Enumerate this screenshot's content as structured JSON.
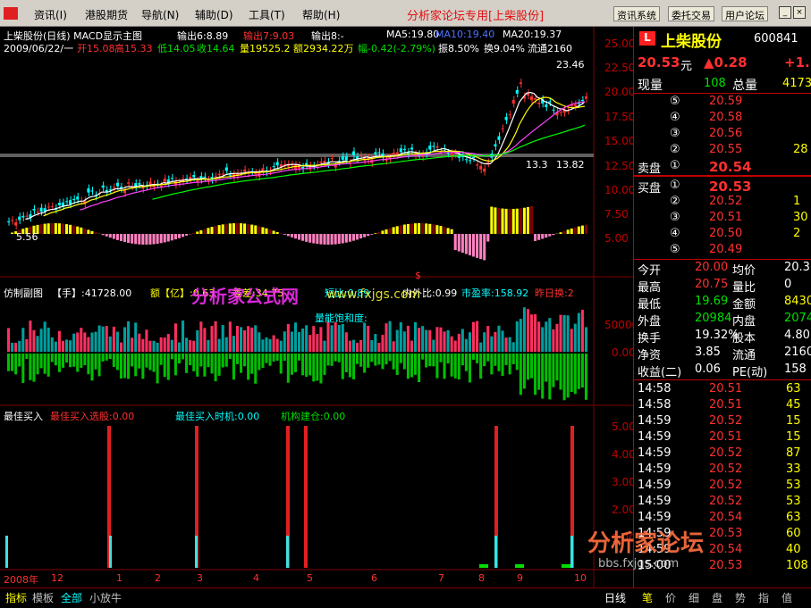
{
  "menu": {
    "items": [
      "资讯(I)",
      "港股期货",
      "导航(N)",
      "辅助(D)",
      "工具(T)",
      "帮助(H)"
    ],
    "title": "分析家论坛专用[上柴股份]",
    "buttons": [
      "资讯系统",
      "委托交易",
      "用户论坛"
    ]
  },
  "header": {
    "line1": "上柴股份(日线) MACD显示主图",
    "out1": "输出6:8.89",
    "out2": "输出7:9.03",
    "out3": "输出8:-",
    "ma5": "MA5:19.80",
    "ma10": "MA10:19.40",
    "ma20": "MA20:19.37",
    "date": "2009/06/22/一",
    "open": "开15.08",
    "high": "高15.33",
    "low": "低14.05",
    "close": "收14.64",
    "vol": "量19525.2",
    "amt": "额2934.22万",
    "chg": "幅-0.42(-2.79%)",
    "amp": "振8.50%",
    "turn": "换9.04%",
    "flow": "流通2160"
  },
  "price_ticks": [
    "25.00",
    "22.50",
    "20.00",
    "17.50",
    "15.00",
    "12.50",
    "10.00",
    "7.50",
    "5.00"
  ],
  "chart_marks": {
    "high": "23.46",
    "low": "13.82",
    "low2": "13.3",
    "left": "5.56",
    "dollar": "$"
  },
  "sub1": {
    "label": "仿制副图",
    "hand": "【手】:41728.00",
    "amount": "额【亿】:0.63",
    "other": "委差:34.75",
    "ratio": "短比:0.89",
    "inout": "内外比:0.99",
    "pe": "市盈率:158.92",
    "prev": "昨日换:2",
    "sat": "量能饱和度:",
    "ticks": [
      "50000",
      "0.00"
    ]
  },
  "sub2": {
    "label": "最佳买入",
    "buy1": "最佳买入选股:0.00",
    "buy2": "最佳买入时机:0.00",
    "buy3": "机构建仓:0.00",
    "ticks": [
      "5.00",
      "4.00",
      "3.00",
      "2.00",
      "1.00"
    ]
  },
  "months": [
    "2008年",
    "12",
    "1",
    "2",
    "3",
    "4",
    "5",
    "6",
    "7",
    "8",
    "9",
    "10"
  ],
  "watermark": {
    "a": "分析家公式网",
    "b": "www.fxjgs.com",
    "c": "分析家论坛",
    "d": "bbs.fxjgs.com"
  },
  "bottom_tabs": [
    "指标",
    "模板",
    "全部",
    "小放牛"
  ],
  "period": "日线",
  "right_tabs": [
    "笔",
    "价",
    "细",
    "盘",
    "势",
    "指",
    "值"
  ],
  "quote": {
    "logo": "L",
    "name": "上柴股份",
    "code": "600841",
    "price": "20.53",
    "unit": "元",
    "arrow": "▲0.28",
    "pct": "+1.",
    "now_label": "现量",
    "now_val": "108",
    "total_label": "总量",
    "total_val": "4173",
    "asks": [
      {
        "lvl": "⑤",
        "p": "20.59",
        "v": ""
      },
      {
        "lvl": "④",
        "p": "20.58",
        "v": ""
      },
      {
        "lvl": "③",
        "p": "20.56",
        "v": ""
      },
      {
        "lvl": "②",
        "p": "20.55",
        "v": "28"
      },
      {
        "lvl": "①",
        "p": "20.54",
        "v": ""
      }
    ],
    "ask_label": "卖盘",
    "bid_label": "买盘",
    "bids": [
      {
        "lvl": "①",
        "p": "20.53",
        "v": ""
      },
      {
        "lvl": "②",
        "p": "20.52",
        "v": "1"
      },
      {
        "lvl": "③",
        "p": "20.51",
        "v": "30"
      },
      {
        "lvl": "④",
        "p": "20.50",
        "v": "2"
      },
      {
        "lvl": "⑤",
        "p": "20.49",
        "v": ""
      }
    ],
    "stats": [
      {
        "a": "今开",
        "av": "20.00",
        "b": "均价",
        "bv": "20.3"
      },
      {
        "a": "最高",
        "av": "20.75",
        "b": "量比",
        "bv": "0"
      },
      {
        "a": "最低",
        "av": "19.69",
        "b": "金额",
        "bv": "8430"
      },
      {
        "a": "外盘",
        "av": "20984",
        "b": "内盘",
        "bv": "2074"
      },
      {
        "a": "换手",
        "av": "19.32%",
        "b": "股本",
        "bv": "4.80"
      },
      {
        "a": "净资",
        "av": "3.85",
        "b": "流通",
        "bv": "2160"
      },
      {
        "a": "收益(二)",
        "av": "0.06",
        "b": "PE(动)",
        "bv": "158"
      }
    ],
    "ticks": [
      {
        "t": "14:58",
        "p": "20.51",
        "v": "63"
      },
      {
        "t": "14:58",
        "p": "20.51",
        "v": "45"
      },
      {
        "t": "14:59",
        "p": "20.52",
        "v": "15"
      },
      {
        "t": "14:59",
        "p": "20.51",
        "v": "15"
      },
      {
        "t": "14:59",
        "p": "20.52",
        "v": "87"
      },
      {
        "t": "14:59",
        "p": "20.52",
        "v": "33"
      },
      {
        "t": "14:59",
        "p": "20.52",
        "v": "53"
      },
      {
        "t": "14:59",
        "p": "20.52",
        "v": "53"
      },
      {
        "t": "14:59",
        "p": "20.54",
        "v": "63"
      },
      {
        "t": "14:59",
        "p": "20.53",
        "v": "60"
      },
      {
        "t": "14:59",
        "p": "20.54",
        "v": "40"
      },
      {
        "t": "15:00",
        "p": "20.53",
        "v": "108"
      }
    ]
  }
}
